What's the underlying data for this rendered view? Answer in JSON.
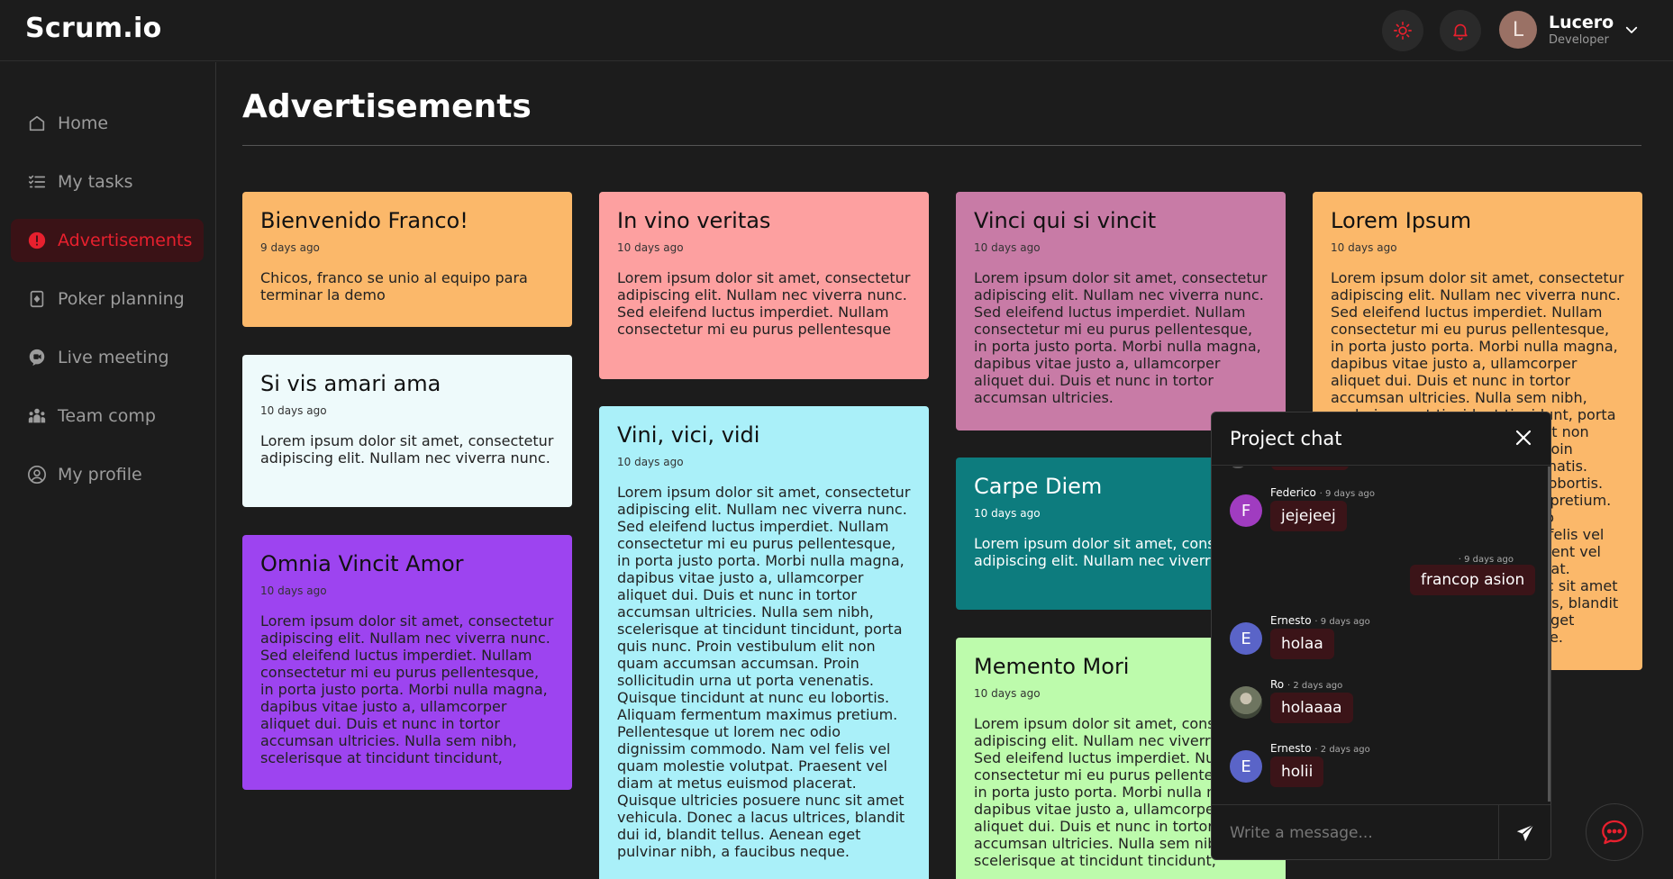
{
  "app": {
    "logo": "Scrum.io"
  },
  "header": {
    "user": {
      "initial": "L",
      "name": "Lucero",
      "role": "Developer"
    }
  },
  "sidebar": {
    "items": [
      {
        "label": "Home",
        "icon": "home-icon"
      },
      {
        "label": "My tasks",
        "icon": "tasks-icon"
      },
      {
        "label": "Advertisements",
        "icon": "alert-icon",
        "active": true
      },
      {
        "label": "Poker planning",
        "icon": "poker-icon"
      },
      {
        "label": "Live meeting",
        "icon": "meeting-icon"
      },
      {
        "label": "Team comp",
        "icon": "team-icon"
      },
      {
        "label": "My profile",
        "icon": "profile-icon"
      }
    ]
  },
  "page": {
    "title": "Advertisements"
  },
  "cards": [
    {
      "title": "Bienvenido Franco!",
      "date": "9 days ago",
      "body": "Chicos, franco se unio al equipo para terminar la demo",
      "color": "#fbb86a"
    },
    {
      "title": "Si vis amari ama",
      "date": "10 days ago",
      "body": "Lorem ipsum dolor sit amet, consectetur adipiscing elit. Nullam nec viverra nunc.",
      "color": "#eefafb"
    },
    {
      "title": "Omnia Vincit Amor",
      "date": "10 days ago",
      "body": "Lorem ipsum dolor sit amet, consectetur adipiscing elit. Nullam nec viverra nunc. Sed eleifend luctus imperdiet. Nullam consectetur mi eu purus pellentesque, in porta justo porta. Morbi nulla magna, dapibus vitae justo a, ullamcorper aliquet dui. Duis et nunc in tortor accumsan ultricies. Nulla sem nibh, scelerisque at tincidunt tincidunt,",
      "color": "#9d44f0"
    },
    {
      "title": "In vino veritas",
      "date": "10 days ago",
      "body": "Lorem ipsum dolor sit amet, consectetur adipiscing elit. Nullam nec viverra nunc. Sed eleifend luctus imperdiet. Nullam consectetur mi eu purus pellentesque",
      "color": "#fda0a0"
    },
    {
      "title": "Vini, vici, vidi",
      "date": "10 days ago",
      "body": "Lorem ipsum dolor sit amet, consectetur adipiscing elit. Nullam nec viverra nunc. Sed eleifend luctus imperdiet. Nullam consectetur mi eu purus pellentesque, in porta justo porta. Morbi nulla magna, dapibus vitae justo a, ullamcorper aliquet dui. Duis et nunc in tortor accumsan ultricies. Nulla sem nibh, scelerisque at tincidunt tincidunt, porta quis nunc. Proin vestibulum elit non quam accumsan accumsan. Proin sollicitudin urna ut porta venenatis. Quisque tincidunt at nunc eu lobortis. Aliquam fermentum maximus pretium. Pellentesque ut lorem nec odio dignissim commodo. Nam vel felis vel quam molestie volutpat. Praesent vel diam at metus euismod placerat. Quisque ultricies posuere nunc sit amet vehicula. Donec a lacus ultrices, blandit dui id, blandit tellus. Aenean eget pulvinar nibh, a faucibus neque.",
      "color": "#aaf0f9"
    },
    {
      "title": "Vinci qui si vincit",
      "date": "10 days ago",
      "body": "Lorem ipsum dolor sit amet, consectetur adipiscing elit. Nullam nec viverra nunc. Sed eleifend luctus imperdiet. Nullam consectetur mi eu purus pellentesque, in porta justo porta. Morbi nulla magna, dapibus vitae justo a, ullamcorper aliquet dui. Duis et nunc in tortor accumsan ultricies.",
      "color": "#c87ba6"
    },
    {
      "title": "Carpe Diem",
      "date": "10 days ago",
      "body": "Lorem ipsum dolor sit amet, consectetur adipiscing elit. Nullam nec viverra nunc.",
      "color": "#0d7c7e"
    },
    {
      "title": "Memento Mori",
      "date": "10 days ago",
      "body": "Lorem ipsum dolor sit amet, consectetur adipiscing elit. Nullam nec viverra nunc. Sed eleifend luctus imperdiet. Nullam consectetur mi eu purus pellentesque, in porta justo porta. Morbi nulla magna, dapibus vitae justo a, ullamcorper aliquet dui. Duis et nunc in tortor accumsan ultricies. Nulla sem nibh, scelerisque at tincidunt tincidunt,",
      "color": "#bdfbac"
    },
    {
      "title": "Lorem Ipsum",
      "date": "10 days ago",
      "body": "Lorem ipsum dolor sit amet, consectetur adipiscing elit. Nullam nec viverra nunc. Sed eleifend luctus imperdiet. Nullam consectetur mi eu purus pellentesque, in porta justo porta. Morbi nulla magna, dapibus vitae justo a, ullamcorper aliquet dui. Duis et nunc in tortor accumsan ultricies. Nulla sem nibh, scelerisque at tincidunt tincidunt, porta quis nunc. Proin vestibulum elit non quam accumsan accumsan. Proin sollicitudin urna ut porta venenatis. Quisque tincidunt at nunc eu lobortis. Aliquam fermentum maximus pretium. Pellentesque ut lorem nec odio dignissim commodo. Nam vel felis vel quam molestie volutpat. Praesent vel diam at metus euismod placerat. Quisque ultricies posuere nunc sit amet vehicula. Donec a lacus ultrices, blandit dui id, blandit tellus. Aenean eget pulvinar nibh, a faucibus neque.",
      "color": "#fbb86a"
    }
  ],
  "chat": {
    "title": "Project chat",
    "messages": [
      {
        "author": "Federico",
        "initial": "F",
        "time": "9 days ago",
        "text": "jejejeej",
        "avatar_color": "#a03cc0"
      },
      {
        "author": "",
        "initial": "",
        "time": "9 days ago",
        "text": "francop asion",
        "own": true
      },
      {
        "author": "Ernesto",
        "initial": "E",
        "time": "9 days ago",
        "text": "holaa",
        "avatar_color": "#5a64c8"
      },
      {
        "author": "Ro",
        "initial": "",
        "time": "2 days ago",
        "text": "holaaaa",
        "avatar_color": "#6f7a6a",
        "photo": true
      },
      {
        "author": "Ernesto",
        "initial": "E",
        "time": "2 days ago",
        "text": "holii",
        "avatar_color": "#5a64c8"
      }
    ],
    "separator": "·",
    "input_placeholder": "Write a message..."
  },
  "colors": {
    "accent": "#e8202e",
    "background": "#1c1c1c",
    "bubble": "#3b1418"
  }
}
